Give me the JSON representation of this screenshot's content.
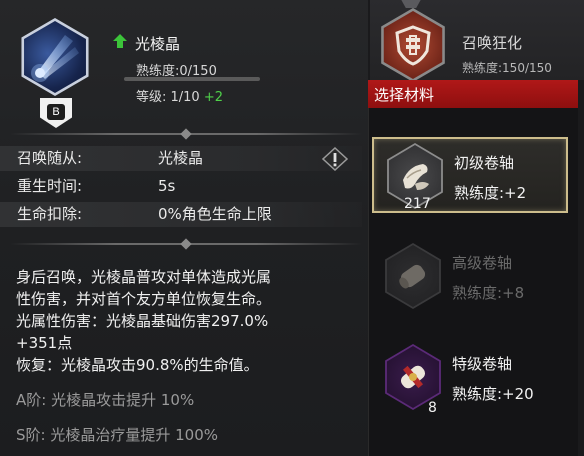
{
  "skill": {
    "name": "光棱晶",
    "grade": "B",
    "proficiency_label": "熟练度:0/150",
    "proficiency_fraction": 0.0,
    "level_label": "等级: 1/10",
    "level_bonus": "+2",
    "icon": "crystal-beam-icon"
  },
  "stats": [
    {
      "label": "召唤随从:",
      "value": "光棱晶"
    },
    {
      "label": "重生时间:",
      "value": "5s"
    },
    {
      "label": "生命扣除:",
      "value": "0%角色生命上限"
    }
  ],
  "description": [
    "身后召唤，光棱晶普攻对单体造成光属",
    "性伤害，并对首个友方单位恢复生命。",
    "光属性伤害：光棱晶基础伤害297.0%",
    "+351点",
    "恢复：光棱晶攻击90.8%的生命值。"
  ],
  "tiers": [
    "A阶: 光棱晶攻击提升 10%",
    "S阶: 光棱晶治疗量提升 100%"
  ],
  "summon_card": {
    "name": "召唤狂化",
    "proficiency": "熟练度:150/150",
    "icon": "shield-emblem-icon"
  },
  "material_panel": {
    "title": "选择材料",
    "items": [
      {
        "name": "初级卷轴",
        "proficiency": "熟练度:+2",
        "count": "217",
        "state": "selected",
        "icon": "scroll-icon"
      },
      {
        "name": "高级卷轴",
        "proficiency": "熟练度:+8",
        "count": "",
        "state": "disabled",
        "icon": "scroll-icon"
      },
      {
        "name": "特级卷轴",
        "proficiency": "熟练度:+20",
        "count": "8",
        "state": "normal",
        "icon": "sealed-scroll-icon"
      }
    ]
  },
  "colors": {
    "accent_red": "#b01818",
    "bonus_green": "#4fd14a",
    "selected_border": "#cdbd8c"
  }
}
